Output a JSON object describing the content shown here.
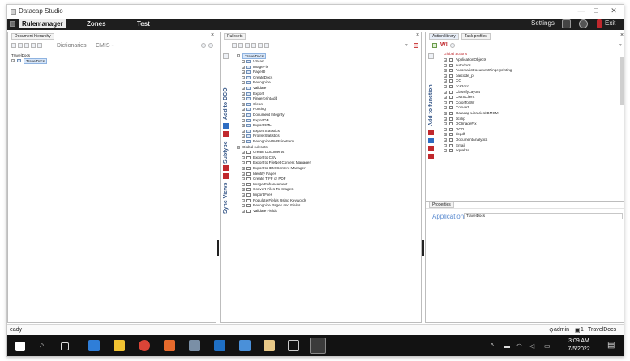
{
  "window": {
    "title": "Datacap Studio",
    "minimize": "—",
    "maximize": "□",
    "close": "✕"
  },
  "menu": {
    "items": [
      "Rulemanager",
      "Zones",
      "Test"
    ],
    "settings": "Settings",
    "exit": "Exit"
  },
  "left_pane": {
    "tab": "Document hierarchy",
    "close": "×",
    "toolbar": {
      "dictionaries": "Dictionaries",
      "cmis": "CMIS -"
    },
    "root_label": "TravelDocs",
    "root_item": "TravelDocs"
  },
  "middle_pane": {
    "tab": "Rulesets",
    "close": "×",
    "help": "? -",
    "root": "TravelDocs",
    "items": [
      "VScan",
      "ImageFix",
      "PageID",
      "CreateDocs",
      "Recognize",
      "Validate",
      "Export",
      "FingerprintAdd",
      "Clean",
      "Routing",
      "Document Integrity",
      "ExportDB",
      "ExportXML",
      "Export Statistics",
      "Profile Statistics",
      "RecognizeOMRLineItem"
    ],
    "global_header": "Global rulesets",
    "global_items": [
      "Create Documents",
      "Export to CSV",
      "Export to FileNet Content Manager",
      "Export to IBM Content Manager",
      "Identify Pages",
      "Create TIFF or PDF",
      "Image Enhancement",
      "Convert Files To Images",
      "Import Files",
      "Populate Fields Using Keywords",
      "Recognize Pages and Fields",
      "Validate Fields"
    ],
    "side_tabs": [
      "Add to DCO",
      "Subtype",
      "Sync Views"
    ]
  },
  "right_pane": {
    "tab_action": "Action library",
    "tab_task": "Task profiles",
    "close": "×",
    "help": "?",
    "global_actions": "Global actions",
    "side_tab": "Add to function",
    "items": [
      "ApplicationObjects",
      "autodocs",
      "AutomaticDocumentFingerprinting",
      "barcode_p",
      "CC",
      "ccs2cco",
      "ClassifyLayout",
      "CMISClient",
      "ColorToBW",
      "Convert",
      "Datacap Libraries/IBMCM",
      "dcclip",
      "DCImageFix",
      "DCO",
      "dcpdf",
      "DocumentAnalytics",
      "Email",
      "equalize"
    ],
    "properties_tab": "Properties",
    "application_label": "Application",
    "application_value": "TravelDocs"
  },
  "status": {
    "left": "eady",
    "user": "admin",
    "count": "1",
    "app": "TravelDocs"
  },
  "taskbar": {
    "time": "3:09 AM",
    "date": "7/5/2022"
  },
  "colors": {
    "menubar": "#1e1e1e",
    "taskbar": "#121212",
    "accent": "#5b8bd0"
  }
}
